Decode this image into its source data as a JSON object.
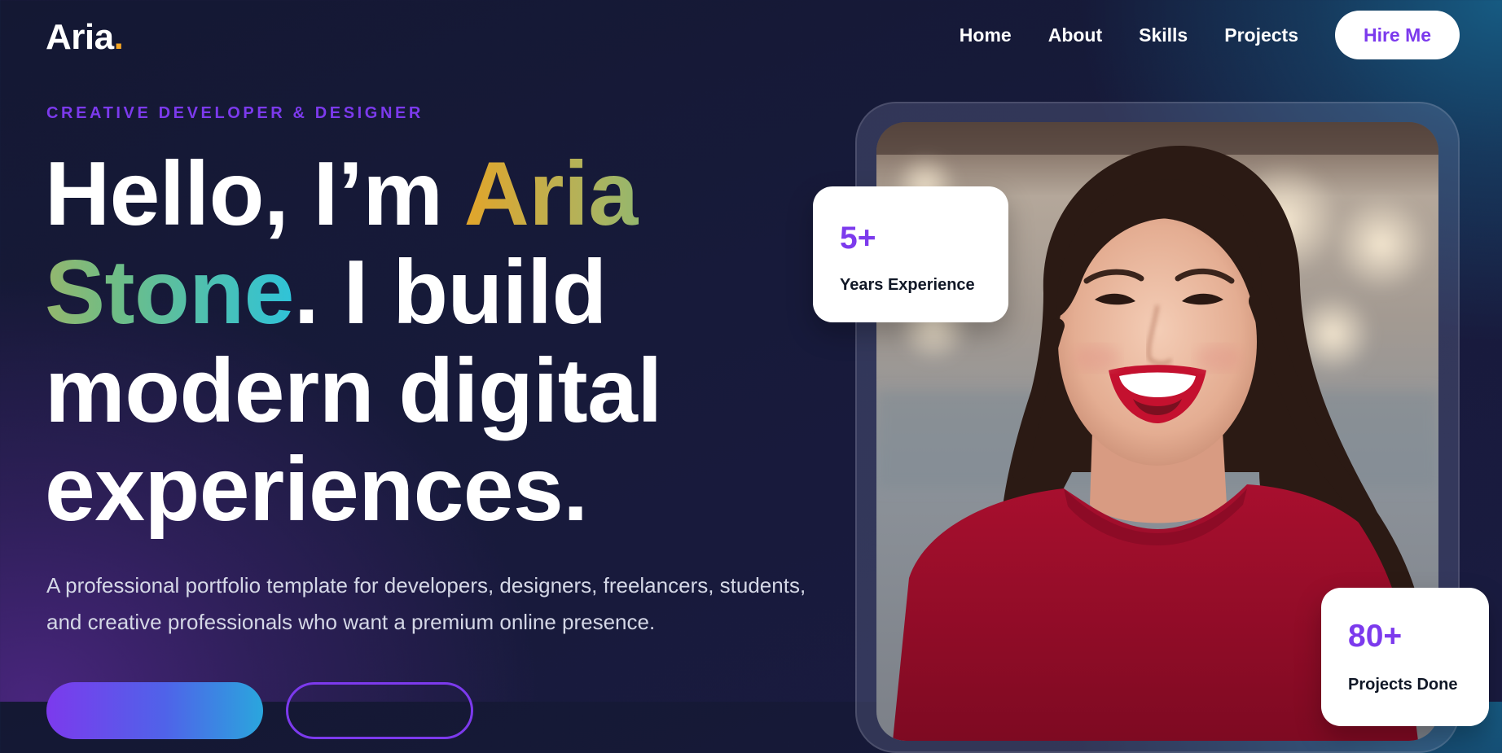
{
  "logo": {
    "text": "Aria",
    "dot": "."
  },
  "nav": {
    "items": [
      {
        "label": "Home"
      },
      {
        "label": "About"
      },
      {
        "label": "Skills"
      },
      {
        "label": "Projects"
      }
    ],
    "cta_label": "Hire Me"
  },
  "hero": {
    "eyebrow": "CREATIVE DEVELOPER & DESIGNER",
    "headline": {
      "prefix": "Hello, I’m ",
      "name": "Aria Stone",
      "suffix": ". I build modern digital experiences."
    },
    "intro": "A professional portfolio template for developers, designers, freelancers, students, and creative professionals who want a premium online presence."
  },
  "stats": [
    {
      "value": "5+",
      "label": "Years Experience"
    },
    {
      "value": "80+",
      "label": "Projects Done"
    }
  ],
  "colors": {
    "accent_purple": "#7c3aed",
    "logo_dot": "#f5a623",
    "name_gradient_start": "#e2a52a",
    "name_gradient_end": "#2fc3d9",
    "background_dark": "#171a3a",
    "card_background": "#ffffff"
  }
}
